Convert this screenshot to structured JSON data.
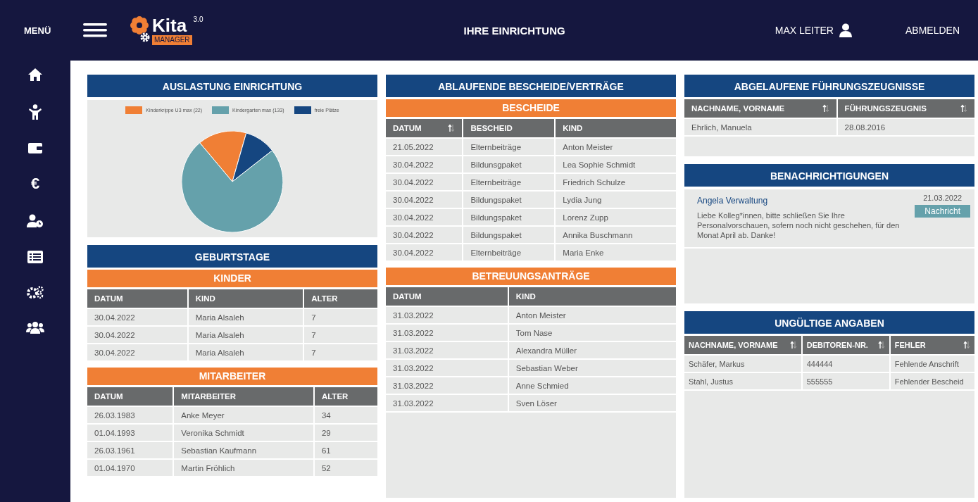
{
  "top_bar": {
    "menu_label": "MENÜ",
    "logo": {
      "name": "Kita",
      "badge": "MANAGER",
      "version": "3.0"
    },
    "page_title": "IHRE EINRICHTUNG",
    "user": "MAX LEITER",
    "logout": "ABMELDEN"
  },
  "sidebar": {
    "items": [
      {
        "kind": "home"
      },
      {
        "kind": "child"
      },
      {
        "kind": "wallet"
      },
      {
        "kind": "text",
        "label": "€"
      },
      {
        "kind": "user-clock"
      },
      {
        "kind": "list"
      },
      {
        "kind": "gears"
      },
      {
        "kind": "group"
      }
    ]
  },
  "utilization": {
    "title": "AUSLASTUNG EINRICHTUNG",
    "legend": [
      {
        "label": "Kinderkrippe U3 max (22)",
        "color": "#f07f35"
      },
      {
        "label": "Kindergarten max (133)",
        "color": "#65a1ab"
      },
      {
        "label": "freie Plätze",
        "color": "#154680"
      }
    ]
  },
  "birthdays": {
    "title": "GEBURTSTAGE",
    "children": {
      "title": "KINDER",
      "columns": [
        {
          "label": "DATUM",
          "sortable": false
        },
        {
          "label": "KIND",
          "sortable": false
        },
        {
          "label": "ALTER",
          "sortable": false
        }
      ],
      "rows": [
        [
          "30.04.2022",
          "Maria Alsaleh",
          "7"
        ],
        [
          "30.04.2022",
          "Maria Alsaleh",
          "7"
        ],
        [
          "30.04.2022",
          "Maria Alsaleh",
          "7"
        ]
      ]
    },
    "staff": {
      "title": "MITARBEITER",
      "columns": [
        {
          "label": "DATUM",
          "sortable": false
        },
        {
          "label": "MITARBEITER",
          "sortable": false
        },
        {
          "label": "ALTER",
          "sortable": false
        }
      ],
      "rows": [
        [
          "26.03.1983",
          "Anke Meyer",
          "34"
        ],
        [
          "01.04.1993",
          "Veronika Schmidt",
          "29"
        ],
        [
          "26.03.1961",
          "Sebastian Kaufmann",
          "61"
        ],
        [
          "01.04.1970",
          "Martin Fröhlich",
          "52"
        ]
      ]
    }
  },
  "expiring": {
    "title": "ABLAUFENDE BESCHEIDE/VERTRÄGE",
    "notices": {
      "title": "BESCHEIDE",
      "columns": [
        {
          "label": "DATUM",
          "sortable": true
        },
        {
          "label": "BESCHEID",
          "sortable": false
        },
        {
          "label": "KIND",
          "sortable": false
        }
      ],
      "rows": [
        [
          "21.05.2022",
          "Elternbeiträge",
          "Anton Meister"
        ],
        [
          "30.04.2022",
          "Bildunsgpaket",
          "Lea Sophie Schmidt"
        ],
        [
          "30.04.2022",
          "Elternbeiträge",
          "Friedrich Schulze"
        ],
        [
          "30.04.2022",
          "Bildungspaket",
          "Lydia Jung"
        ],
        [
          "30.04.2022",
          "Bildungspaket",
          "Lorenz Zupp"
        ],
        [
          "30.04.2022",
          "Bildungspaket",
          "Annika Buschmann"
        ],
        [
          "30.04.2022",
          "Elternbeiträge",
          "Maria Enke"
        ]
      ]
    },
    "applications": {
      "title": "BETREUUNGSANTRÄGE",
      "columns": [
        {
          "label": "DATUM",
          "sortable": false
        },
        {
          "label": "KIND",
          "sortable": false
        }
      ],
      "rows": [
        [
          "31.03.2022",
          "Anton Meister"
        ],
        [
          "31.03.2022",
          "Tom Nase"
        ],
        [
          "31.03.2022",
          "Alexandra Müller"
        ],
        [
          "31.03.2022",
          "Sebastian Weber"
        ],
        [
          "31.03.2022",
          "Anne Schmied"
        ],
        [
          "31.03.2022",
          "Sven Löser"
        ]
      ]
    }
  },
  "certificates": {
    "title": "ABGELAUFENE FÜHRUNGSZEUGNISSE",
    "columns": [
      {
        "label": "NACHNAME, VORNAME",
        "sortable": true
      },
      {
        "label": "FÜHRUNGSZEUGNIS",
        "sortable": true
      }
    ],
    "rows": [
      [
        "Ehrlich, Manuela",
        "28.08.2016"
      ]
    ]
  },
  "notifications": {
    "title": "BENACHRICHTIGUNGEN",
    "items": [
      {
        "sender": "Angela Verwaltung",
        "date": "21.03.2022",
        "text": "Liebe Kolleg*innen, bitte schließen Sie Ihre Personalvorschauen, sofern noch nicht geschehen, für den Monat April ab. Danke!",
        "tag": "Nachricht"
      }
    ]
  },
  "invalid": {
    "title": "UNGÜLTIGE ANGABEN",
    "columns": [
      {
        "label": "NACHNAME, VORNAME",
        "sortable": true
      },
      {
        "label": "DEBITOREN-NR.",
        "sortable": true
      },
      {
        "label": "FEHLER",
        "sortable": true
      }
    ],
    "rows": [
      [
        "Schäfer, Markus",
        "444444",
        "Fehlende Anschrift"
      ],
      [
        "Stahl, Justus",
        "555555",
        "Fehlender Bescheid"
      ]
    ]
  }
}
